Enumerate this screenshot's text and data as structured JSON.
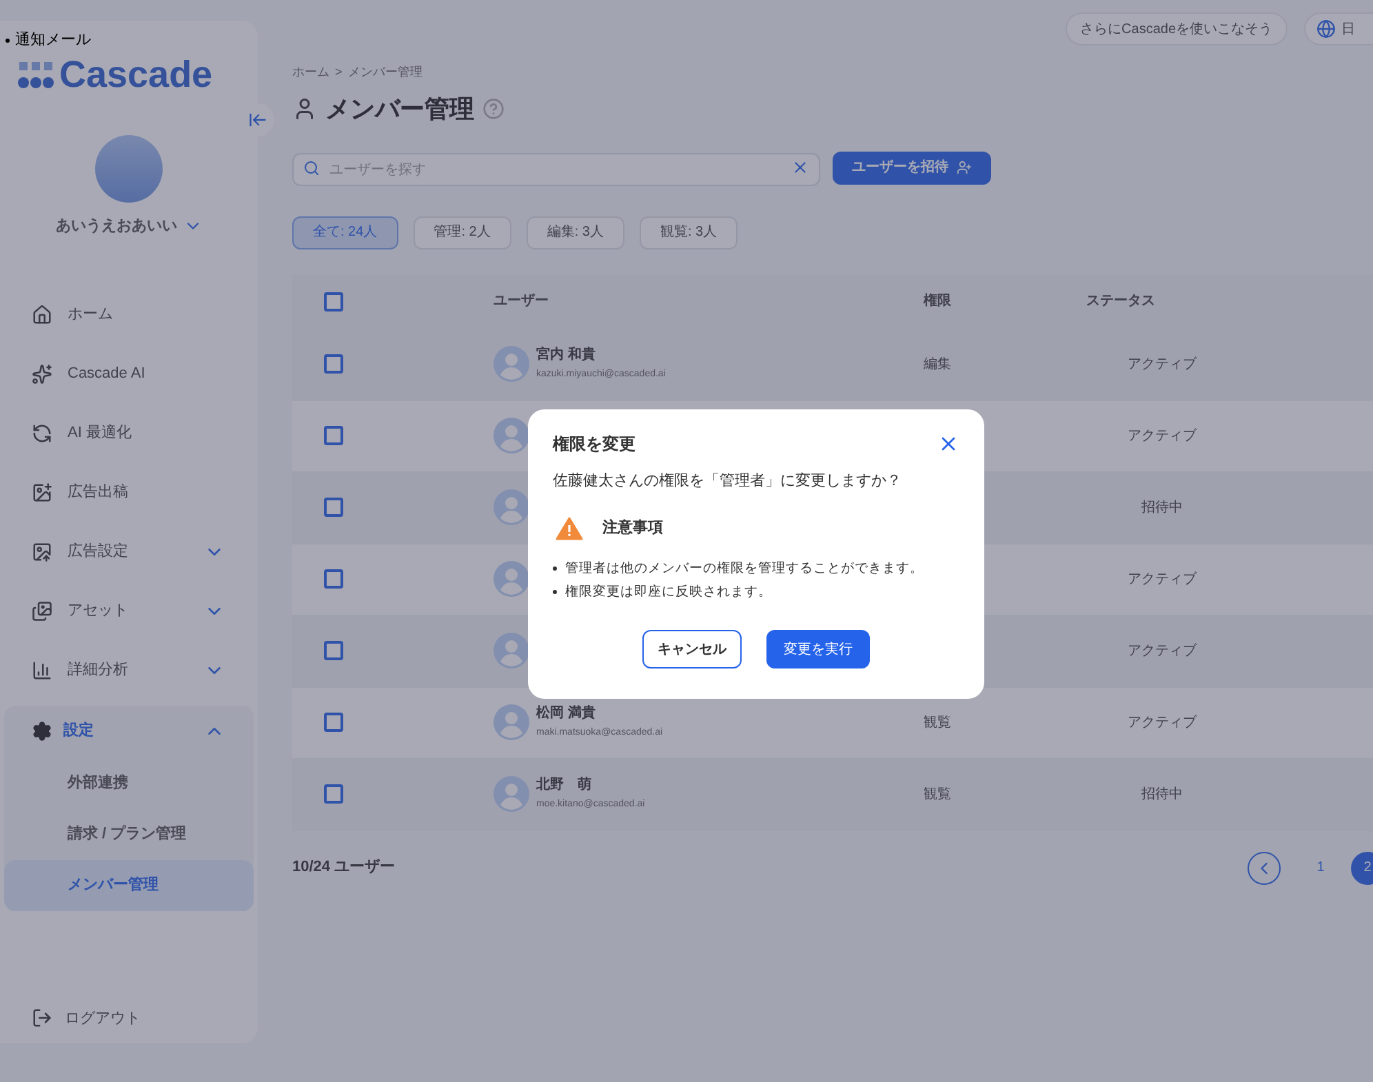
{
  "notice_item": "通知メール",
  "sidebar": {
    "logo": "Cascade",
    "user_name": "あいうえおあいい",
    "items": [
      {
        "label": "ホーム"
      },
      {
        "label": "Cascade AI"
      },
      {
        "label": "AI 最適化"
      },
      {
        "label": "広告出稿"
      },
      {
        "label": "広告設定",
        "expanded": false
      },
      {
        "label": "アセット",
        "expanded": false
      },
      {
        "label": "詳細分析",
        "expanded": false
      }
    ],
    "settings": {
      "label": "設定",
      "expanded": true,
      "children": [
        {
          "label": "外部連携",
          "selected": false
        },
        {
          "label": "請求 / プラン管理",
          "selected": false
        },
        {
          "label": "メンバー管理",
          "selected": true
        }
      ]
    },
    "logout": "ログアウト"
  },
  "header": {
    "promo": "さらにCascadeを使いこなそう",
    "language": "日"
  },
  "breadcrumb": [
    "ホーム",
    ">",
    "メンバー管理"
  ],
  "title": "メンバー管理",
  "search": {
    "placeholder": "ユーザーを探す"
  },
  "invite_button": "ユーザーを招待",
  "filters": [
    {
      "label": "全て: 24人",
      "selected": true
    },
    {
      "label": "管理: 2人",
      "selected": false
    },
    {
      "label": "編集: 3人",
      "selected": false
    },
    {
      "label": "観覧: 3人",
      "selected": false
    }
  ],
  "table": {
    "select_all_checked": false,
    "columns": [
      "ユーザー",
      "権限",
      "ステータス"
    ],
    "rows": [
      {
        "name": "宮内 和貴",
        "email": "kazuki.miyauchi@cascaded.ai",
        "role": "編集",
        "status": "アクティブ",
        "checked": false
      },
      {
        "status": "アクティブ",
        "checked": false
      },
      {
        "status": "招待中",
        "checked": false
      },
      {
        "status": "アクティブ",
        "checked": false
      },
      {
        "status": "アクティブ",
        "checked": false
      },
      {
        "name": "松岡 満貴",
        "email": "maki.matsuoka@cascaded.ai",
        "role": "観覧",
        "status": "アクティブ",
        "checked": false
      },
      {
        "name": "北野　萌",
        "email": "moe.kitano@cascaded.ai",
        "role": "観覧",
        "status": "招待中",
        "checked": false
      }
    ]
  },
  "footer": {
    "count": "10/24 ユーザー",
    "pages": [
      {
        "label": "1",
        "selected": false
      },
      {
        "label": "2",
        "selected": true
      }
    ]
  },
  "dialog": {
    "title": "権限を変更",
    "message": "佐藤健太さんの権限を「管理者」に変更しますか？",
    "notice_title": "注意事項",
    "notes": [
      "管理者は他のメンバーの権限を管理することができます。",
      "権限変更は即座に反映されます。"
    ],
    "cancel": "キャンセル",
    "confirm": "変更を実行"
  }
}
